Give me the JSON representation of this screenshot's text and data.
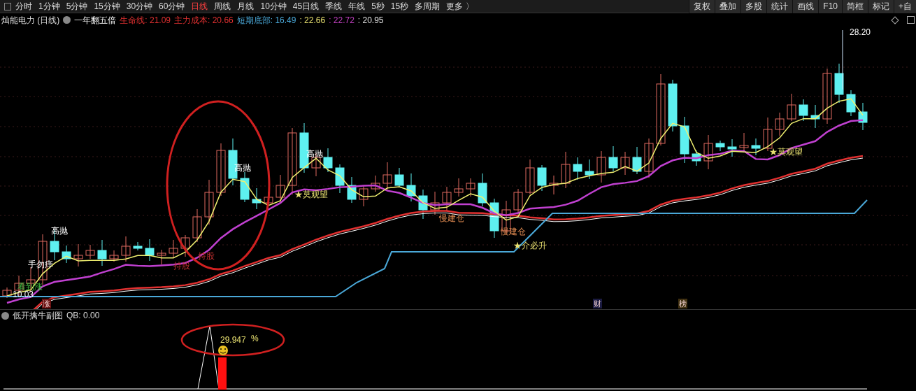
{
  "toolbar": {
    "periods": [
      {
        "label": "分时",
        "selected": false
      },
      {
        "label": "1分钟",
        "selected": false
      },
      {
        "label": "5分钟",
        "selected": false
      },
      {
        "label": "15分钟",
        "selected": false
      },
      {
        "label": "30分钟",
        "selected": false
      },
      {
        "label": "60分钟",
        "selected": false
      },
      {
        "label": "日线",
        "selected": true
      },
      {
        "label": "周线",
        "selected": false
      },
      {
        "label": "月线",
        "selected": false
      },
      {
        "label": "10分钟",
        "selected": false
      },
      {
        "label": "45日线",
        "selected": false
      },
      {
        "label": "季线",
        "selected": false
      },
      {
        "label": "年线",
        "selected": false
      },
      {
        "label": "5秒",
        "selected": false
      },
      {
        "label": "15秒",
        "selected": false
      },
      {
        "label": "多周期",
        "selected": false
      },
      {
        "label": "更多 〉",
        "selected": false
      }
    ],
    "buttons": [
      "复权",
      "叠加",
      "多股",
      "统计",
      "画线",
      "F10",
      "简框",
      "标记",
      "+自"
    ]
  },
  "info": {
    "stock": "灿能电力 (日线)",
    "formula": "一年翻五倍",
    "values": [
      {
        "text": "生命线: 21.09",
        "color": "#e03030"
      },
      {
        "text": "主力成本: 20.66",
        "color": "#e03030"
      },
      {
        "text": "短期底部: 16.49",
        "color": "#4aa8d8"
      },
      {
        "text": ": 22.66",
        "color": "#e8e070"
      },
      {
        "text": ": 22.72",
        "color": "#c040c0"
      },
      {
        "text": ": 20.95",
        "color": "#e0e0e0"
      }
    ]
  },
  "chart_labels": [
    {
      "text": "高抛",
      "kind": "sell"
    },
    {
      "text": "手勿痒",
      "kind": "sell"
    },
    {
      "text": "看到涨",
      "kind": "rise"
    },
    {
      "text": "10.03",
      "kind": "price"
    },
    {
      "text": "持股",
      "kind": "hold"
    },
    {
      "text": "持股",
      "kind": "hold"
    },
    {
      "text": "高抛",
      "kind": "sell"
    },
    {
      "text": "高抛",
      "kind": "sell"
    },
    {
      "text": "★莫观望",
      "kind": "watch"
    },
    {
      "text": "慢建仓",
      "kind": "build"
    },
    {
      "text": "慢建仓",
      "kind": "build"
    },
    {
      "text": "★介必升",
      "kind": "watch"
    },
    {
      "text": "★莫观望",
      "kind": "watch"
    },
    {
      "text": "28.20",
      "kind": "price"
    }
  ],
  "markers": [
    {
      "text": "涨",
      "color": "#6a1010"
    },
    {
      "text": "财",
      "color": "#1a1a40"
    },
    {
      "text": "榜",
      "color": "#403010"
    }
  ],
  "sub_chart": {
    "title": "低开擒牛副图",
    "qb": "QB: 0.00",
    "value": "29.947",
    "unit": "%"
  }
}
